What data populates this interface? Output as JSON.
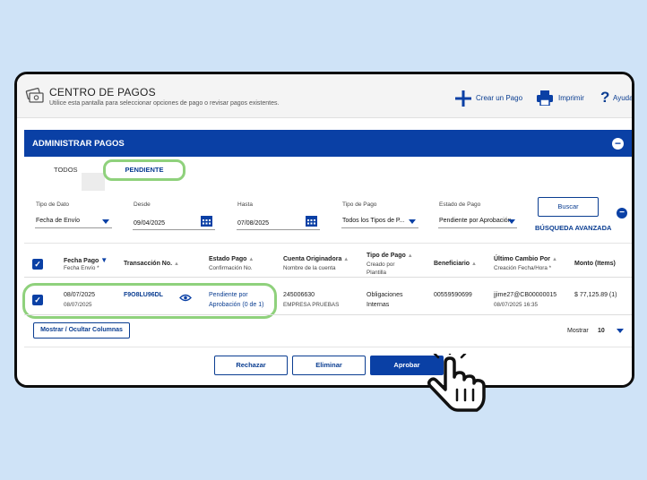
{
  "header": {
    "title": "CENTRO DE PAGOS",
    "subtitle": "Utilice esta pantalla para seleccionar opciones de pago o revisar pagos existentes.",
    "create_label": "Crear un Pago",
    "print_label": "Imprimir",
    "help_label": "Ayuda"
  },
  "panel": {
    "title": "ADMINISTRAR PAGOS",
    "collapse_symbol": "−"
  },
  "tabs": [
    {
      "label": "TODOS"
    },
    {
      "label": "PENDIENTE"
    }
  ],
  "filters": {
    "tipo_dato": {
      "label": "Tipo de Dato",
      "value": "Fecha de Envío"
    },
    "desde": {
      "label": "Desde",
      "value": "09/04/2025"
    },
    "hasta": {
      "label": "Hasta",
      "value": "07/08/2025"
    },
    "tipo_pago": {
      "label": "Tipo de Pago",
      "value": "Todos los Tipos de P..."
    },
    "estado_pago": {
      "label": "Estado de Pago",
      "value": "Pendiente por Aprobación"
    },
    "search_label": "Buscar",
    "advanced_label": "BÚSQUEDA AVANZADA",
    "minus_symbol": "−"
  },
  "table": {
    "columns": [
      {
        "title": "Fecha Pago",
        "sub": "Fecha Envío *"
      },
      {
        "title": "Transacción No.",
        "sub": ""
      },
      {
        "title": "Estado Pago",
        "sub": "Confirmación No."
      },
      {
        "title": "Cuenta Originadora",
        "sub": "Nombre de la cuenta"
      },
      {
        "title": "Tipo de Pago",
        "sub": "Creado por",
        "sub2": "Plantilla"
      },
      {
        "title": "Beneficiario",
        "sub": ""
      },
      {
        "title": "Último Cambio Por",
        "sub": "Creación Fecha/Hora *"
      },
      {
        "title": "Monto (Items)",
        "sub": ""
      }
    ],
    "row": {
      "fecha_pago": "08/07/2025",
      "fecha_envio": "08/07/2025",
      "transaccion": "F9O8LU96DL",
      "estado_1": "Pendiente por",
      "estado_2": "Aprobación (0 de 1)",
      "cuenta": "245006630",
      "cuenta_nombre": "EMPRESA PRUEBAS",
      "tipo_1": "Obligaciones",
      "tipo_2": "Internas",
      "beneficiario": "00559590699",
      "cambio_por": "jjime27@CB00000015",
      "creacion": "08/07/2025 16:35",
      "monto": "$ 77,125.89 (1)"
    },
    "columns_button": "Mostrar / Ocultar Columnas",
    "show_label": "Mostrar",
    "show_value": "10"
  },
  "actions": {
    "reject": "Rechazar",
    "delete": "Eliminar",
    "approve": "Aprobar"
  },
  "colors": {
    "brand_blue": "#0a40a5",
    "highlight_green": "#8fd17c"
  }
}
